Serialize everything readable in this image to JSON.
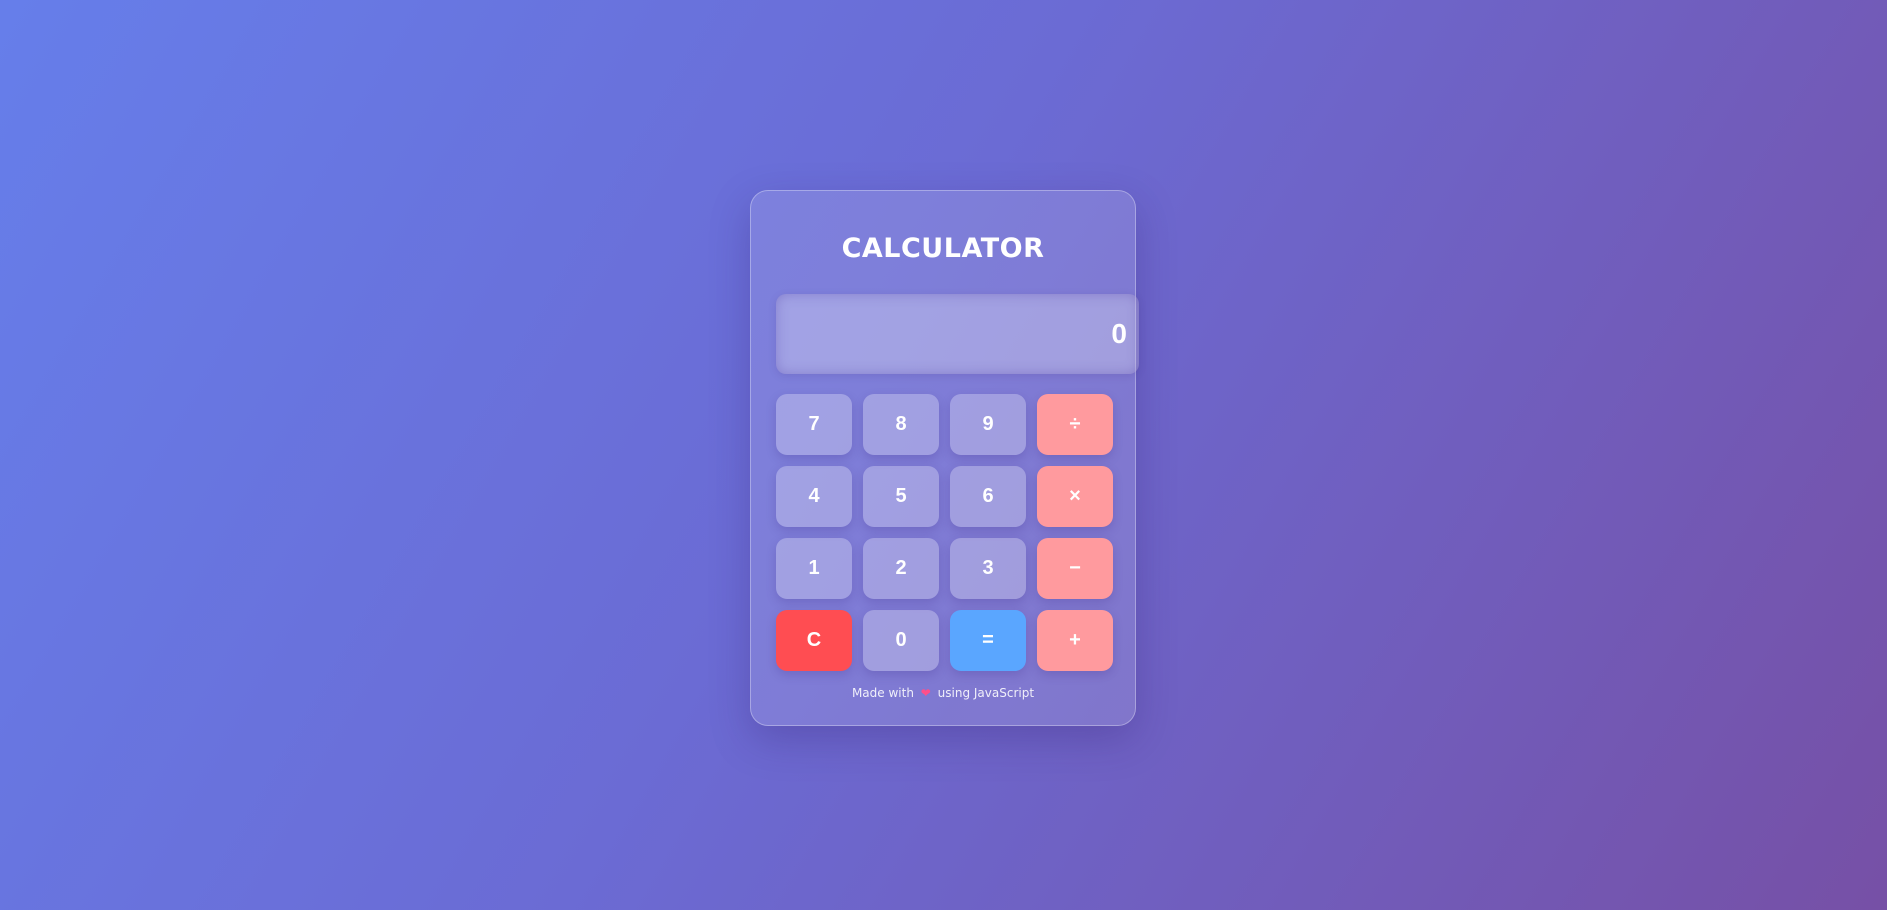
{
  "app": {
    "title": "CALCULATOR"
  },
  "display": {
    "value": "0"
  },
  "keys": [
    {
      "label": "7",
      "kind": "digit",
      "name": "key-7"
    },
    {
      "label": "8",
      "kind": "digit",
      "name": "key-8"
    },
    {
      "label": "9",
      "kind": "digit",
      "name": "key-9"
    },
    {
      "label": "÷",
      "kind": "op",
      "name": "divide-button"
    },
    {
      "label": "4",
      "kind": "digit",
      "name": "key-4"
    },
    {
      "label": "5",
      "kind": "digit",
      "name": "key-5"
    },
    {
      "label": "6",
      "kind": "digit",
      "name": "key-6"
    },
    {
      "label": "×",
      "kind": "op",
      "name": "multiply-button"
    },
    {
      "label": "1",
      "kind": "digit",
      "name": "key-1"
    },
    {
      "label": "2",
      "kind": "digit",
      "name": "key-2"
    },
    {
      "label": "3",
      "kind": "digit",
      "name": "key-3"
    },
    {
      "label": "−",
      "kind": "op",
      "name": "subtract-button"
    },
    {
      "label": "C",
      "kind": "clear",
      "name": "clear-button"
    },
    {
      "label": "0",
      "kind": "digit",
      "name": "key-0"
    },
    {
      "label": "=",
      "kind": "equals",
      "name": "equals-button"
    },
    {
      "label": "+",
      "kind": "op",
      "name": "add-button"
    }
  ],
  "footer": {
    "prefix": "Made with",
    "icon": "heart-icon",
    "suffix": "using JavaScript"
  },
  "colors": {
    "operator": "#ff9a9e",
    "clear": "#ff4d52",
    "equals": "#5aa6ff",
    "heart": "#ff4f8a"
  }
}
